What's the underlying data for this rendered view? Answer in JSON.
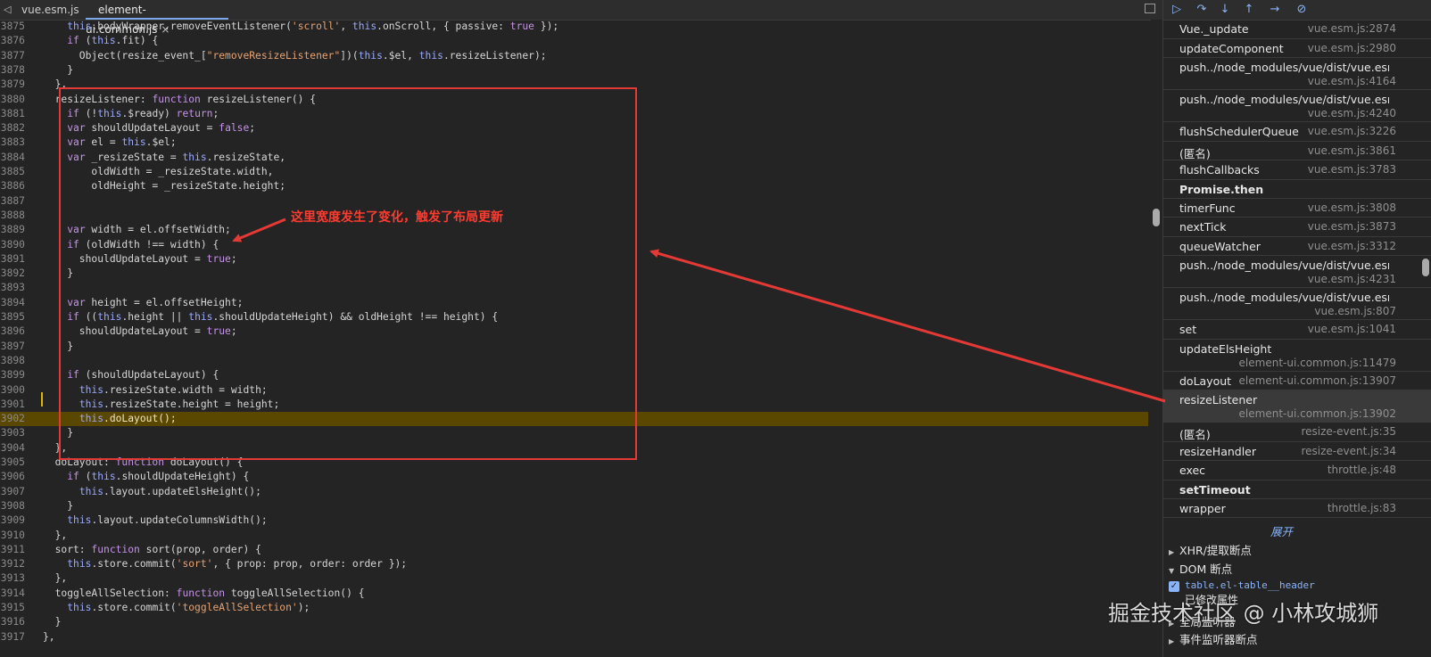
{
  "editor": {
    "tabs": [
      {
        "label": "vue.esm.js",
        "active": false
      },
      {
        "label": "element-ui.common.js",
        "active": true
      }
    ],
    "tab_close_glyph": "×",
    "lines": [
      {
        "n": "3875",
        "text": "    this.bodyWrapper.removeEventListener('scroll', this.onScroll, { passive: true });"
      },
      {
        "n": "3876",
        "text": "    if (this.fit) {"
      },
      {
        "n": "3877",
        "text": "      Object(resize_event_[\"removeResizeListener\"])(this.$el, this.resizeListener);"
      },
      {
        "n": "3878",
        "text": "    }"
      },
      {
        "n": "3879",
        "text": "  },"
      },
      {
        "n": "3880",
        "text": "  resizeListener: function resizeListener() {"
      },
      {
        "n": "3881",
        "text": "    if (!this.$ready) return;"
      },
      {
        "n": "3882",
        "text": "    var shouldUpdateLayout = false;"
      },
      {
        "n": "3883",
        "text": "    var el = this.$el;"
      },
      {
        "n": "3884",
        "text": "    var _resizeState = this.resizeState,"
      },
      {
        "n": "3885",
        "text": "        oldWidth = _resizeState.width,"
      },
      {
        "n": "3886",
        "text": "        oldHeight = _resizeState.height;"
      },
      {
        "n": "3887",
        "text": ""
      },
      {
        "n": "3888",
        "text": ""
      },
      {
        "n": "3889",
        "text": "    var width = el.offsetWidth;"
      },
      {
        "n": "3890",
        "text": "    if (oldWidth !== width) {"
      },
      {
        "n": "3891",
        "text": "      shouldUpdateLayout = true;"
      },
      {
        "n": "3892",
        "text": "    }"
      },
      {
        "n": "3893",
        "text": ""
      },
      {
        "n": "3894",
        "text": "    var height = el.offsetHeight;"
      },
      {
        "n": "3895",
        "text": "    if ((this.height || this.shouldUpdateHeight) && oldHeight !== height) {"
      },
      {
        "n": "3896",
        "text": "      shouldUpdateLayout = true;"
      },
      {
        "n": "3897",
        "text": "    }"
      },
      {
        "n": "3898",
        "text": ""
      },
      {
        "n": "3899",
        "text": "    if (shouldUpdateLayout) {"
      },
      {
        "n": "3900",
        "text": "      this.resizeState.width = width;"
      },
      {
        "n": "3901",
        "text": "      this.resizeState.height = height;"
      },
      {
        "n": "3902",
        "text": "      this.doLayout();",
        "current": true
      },
      {
        "n": "3903",
        "text": "    }"
      },
      {
        "n": "3904",
        "text": "  },"
      },
      {
        "n": "3905",
        "text": "  doLayout: function doLayout() {"
      },
      {
        "n": "3906",
        "text": "    if (this.shouldUpdateHeight) {"
      },
      {
        "n": "3907",
        "text": "      this.layout.updateElsHeight();"
      },
      {
        "n": "3908",
        "text": "    }"
      },
      {
        "n": "3909",
        "text": "    this.layout.updateColumnsWidth();"
      },
      {
        "n": "3910",
        "text": "  },"
      },
      {
        "n": "3911",
        "text": "  sort: function sort(prop, order) {"
      },
      {
        "n": "3912",
        "text": "    this.store.commit('sort', { prop: prop, order: order });"
      },
      {
        "n": "3913",
        "text": "  },"
      },
      {
        "n": "3914",
        "text": "  toggleAllSelection: function toggleAllSelection() {"
      },
      {
        "n": "3915",
        "text": "    this.store.commit('toggleAllSelection');"
      },
      {
        "n": "3916",
        "text": "  }"
      },
      {
        "n": "3917",
        "text": "},"
      }
    ]
  },
  "annotation": {
    "text": "这里宽度发生了变化，触发了布局更新",
    "color": "#ff3b30"
  },
  "call_stack": [
    {
      "kind": "frame",
      "name": "Vue._update",
      "loc": "vue.esm.js:2874"
    },
    {
      "kind": "frame",
      "name": "updateComponent",
      "loc": "vue.esm.js:2980"
    },
    {
      "kind": "frame2",
      "name": "push../node_modules/vue/dist/vue.esm.js.Watcher.get",
      "loc": "vue.esm.js:4164"
    },
    {
      "kind": "frame2",
      "name": "push../node_modules/vue/dist/vue.esm.js.Watcher.run",
      "loc": "vue.esm.js:4240"
    },
    {
      "kind": "frame",
      "name": "flushSchedulerQueue",
      "loc": "vue.esm.js:3226"
    },
    {
      "kind": "frame",
      "name": "(匿名)",
      "loc": "vue.esm.js:3861"
    },
    {
      "kind": "frame",
      "name": "flushCallbacks",
      "loc": "vue.esm.js:3783"
    },
    {
      "kind": "async",
      "name": "Promise.then"
    },
    {
      "kind": "frame",
      "name": "timerFunc",
      "loc": "vue.esm.js:3808"
    },
    {
      "kind": "frame",
      "name": "nextTick",
      "loc": "vue.esm.js:3873"
    },
    {
      "kind": "frame",
      "name": "queueWatcher",
      "loc": "vue.esm.js:3312"
    },
    {
      "kind": "frame2",
      "name": "push../node_modules/vue/dist/vue.esm.js.Watcher.update",
      "loc": "vue.esm.js:4231"
    },
    {
      "kind": "frame2",
      "name": "push../node_modules/vue/dist/vue.esm.js.Dep.notify",
      "loc": "vue.esm.js:807"
    },
    {
      "kind": "frame",
      "name": "set",
      "loc": "vue.esm.js:1041"
    },
    {
      "kind": "frame2",
      "name": "updateElsHeight",
      "loc": "element-ui.common.js:11479"
    },
    {
      "kind": "frame",
      "name": "doLayout",
      "loc": "element-ui.common.js:13907"
    },
    {
      "kind": "frame2",
      "name": "resizeListener",
      "loc": "element-ui.common.js:13902",
      "selected": true
    },
    {
      "kind": "frame",
      "name": "(匿名)",
      "loc": "resize-event.js:35"
    },
    {
      "kind": "frame",
      "name": "resizeHandler",
      "loc": "resize-event.js:34"
    },
    {
      "kind": "frame",
      "name": "exec",
      "loc": "throttle.js:48"
    },
    {
      "kind": "async",
      "name": "setTimeout"
    },
    {
      "kind": "frame",
      "name": "wrapper",
      "loc": "throttle.js:83"
    }
  ],
  "panel": {
    "expand_label": "展开",
    "xhr_section": "XHR/提取断点",
    "dom_section": "DOM 断点",
    "dom_breakpoint": {
      "selector": "table.el-table__header",
      "type": "已修改属性",
      "checked": true
    },
    "global_section": "全局监听器",
    "event_section": "事件监听器断点"
  },
  "watermark": "掘金技术社区 @ 小林攻城狮",
  "icons": [
    "back-arrow-icon",
    "close-icon",
    "toggle-pane-icon",
    "resume-icon",
    "step-over-icon",
    "step-into-icon",
    "step-out-icon",
    "step-icon",
    "deactivate-breakpoints-icon"
  ]
}
